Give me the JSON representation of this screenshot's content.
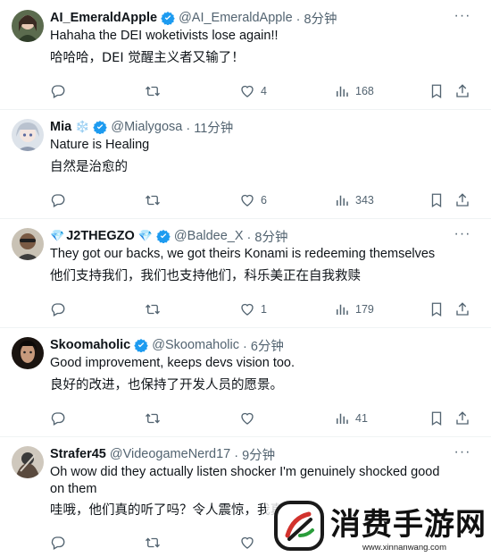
{
  "tweets": [
    {
      "name": "AI_EmeraldApple",
      "emoji": "",
      "handle": "@AI_EmeraldApple",
      "time": "· 8分钟",
      "text": "Hahaha the DEI woketivists lose again!!",
      "translation": "哈哈哈，DEI 觉醒主义者又输了！",
      "likes": "4",
      "views": "168"
    },
    {
      "name": "Mia",
      "emoji": "❄️",
      "handle": "@Mialygosa",
      "time": "· 11分钟",
      "text": "Nature is Healing",
      "translation": "自然是治愈的",
      "likes": "6",
      "views": "343"
    },
    {
      "name": "J2THEGZO",
      "emoji": "💎",
      "handle": "@Baldee_X",
      "time": "· 8分钟",
      "text": "They got our backs, we got theirs Konami is redeeming themselves",
      "translation": "他们支持我们，我们也支持他们，科乐美正在自我救赎",
      "likes": "1",
      "views": "179"
    },
    {
      "name": "Skoomaholic",
      "emoji": "",
      "handle": "@Skoomaholic",
      "time": "· 6分钟",
      "text": "Good improvement, keeps devs vision too.",
      "translation": "良好的改进，也保持了开发人员的愿景。",
      "likes": "",
      "views": "41"
    },
    {
      "name": "Strafer45",
      "emoji": "",
      "handle": "@VideogameNerd17",
      "time": "· 9分钟",
      "text": "Oh wow did they actually listen shocker I'm genuinely shocked good on them",
      "translation": "哇哦，他们真的听了吗？令人震惊，我真",
      "likes": "",
      "views": ""
    }
  ],
  "watermark": {
    "title": "消费手游网",
    "url": "www.xinnanwang.com"
  },
  "colors": {
    "text": "#0f1419",
    "muted": "#536471",
    "verified": "#1d9bf0",
    "divider": "#eff3f4"
  }
}
